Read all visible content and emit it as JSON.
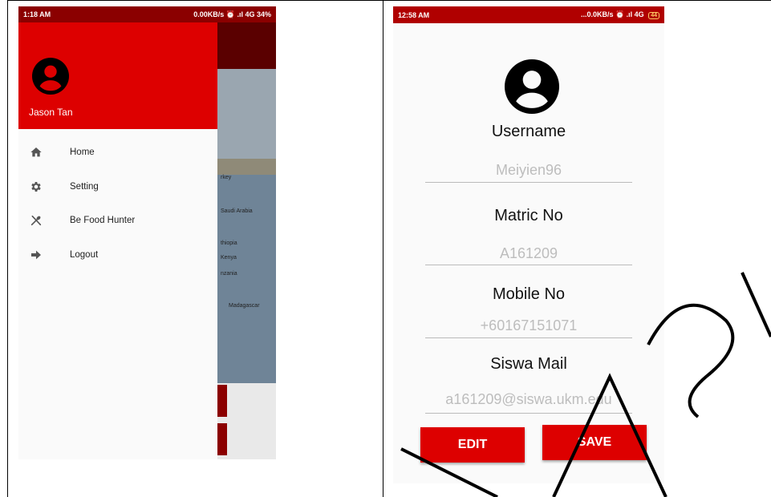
{
  "left_screen": {
    "status": {
      "time": "1:18 AM",
      "right": "0.00KB/s ⏰ .ıl 4G 34%"
    },
    "drawer": {
      "user_name": "Jason Tan",
      "menu": [
        {
          "label": "Home",
          "icon": "home-icon"
        },
        {
          "label": "Setting",
          "icon": "gear-icon"
        },
        {
          "label": "Be Food Hunter",
          "icon": "utensils-icon"
        },
        {
          "label": "Logout",
          "icon": "logout-arrow-icon"
        }
      ]
    },
    "map_labels": [
      "rkey",
      "Saudi Arabia",
      "thiopia",
      "Kenya",
      "nzania",
      "Madagascar"
    ]
  },
  "right_screen": {
    "status": {
      "time": "12:58 AM",
      "right": "...0.0KB/s ⏰ .ıl 4G",
      "battery": "44"
    },
    "fields": [
      {
        "label": "Username",
        "value": "Meiyien96"
      },
      {
        "label": "Matric No",
        "value": "A161209"
      },
      {
        "label": "Mobile No",
        "value": "+60167151071"
      },
      {
        "label": "Siswa Mail",
        "value": "a161209@siswa.ukm.edu"
      }
    ],
    "edit_label": "EDIT",
    "save_label": "SAVE"
  },
  "colors": {
    "primary_red": "#dd0000",
    "status_dark": "#8b0000",
    "watermark": "#000000"
  }
}
